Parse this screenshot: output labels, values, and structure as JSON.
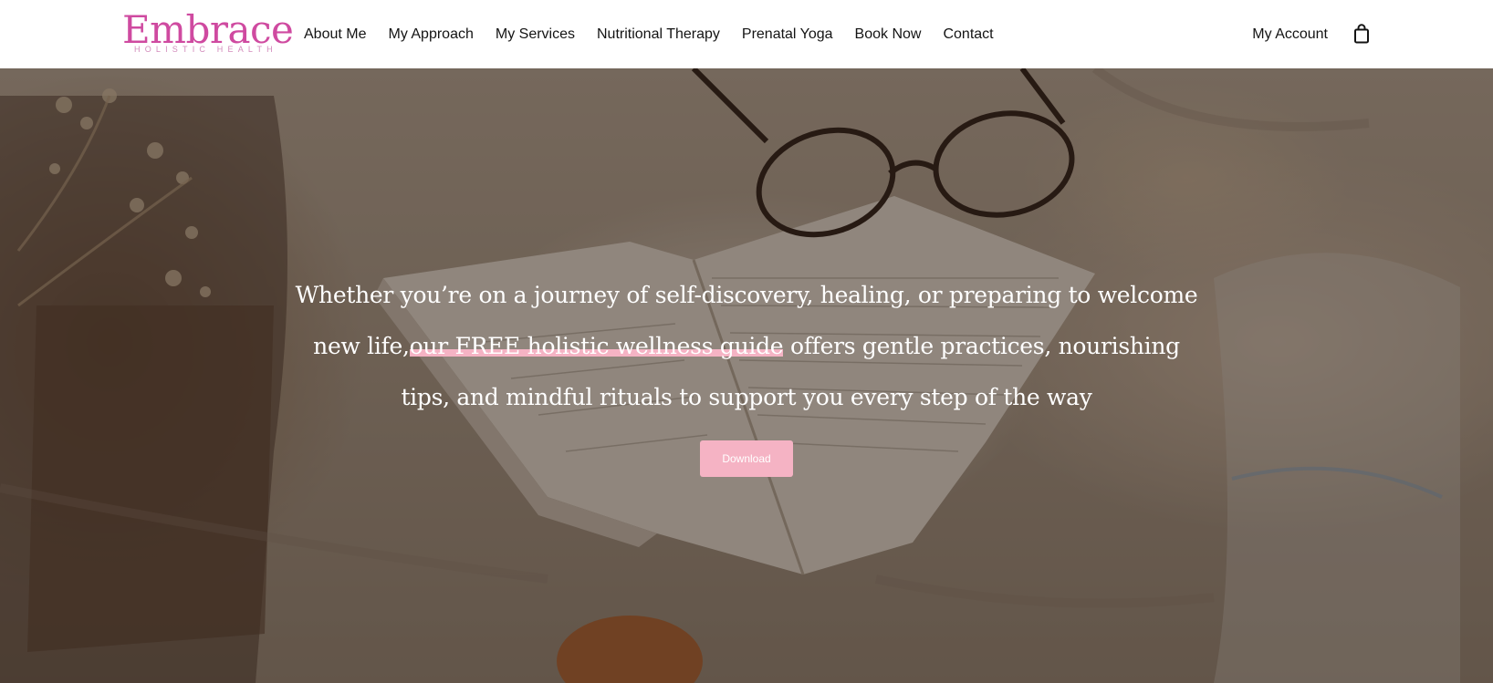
{
  "colors": {
    "brand_pink": "#cf4aa0",
    "button_pink": "#f5b3c4",
    "highlight_pink": "#f5b3c4"
  },
  "header": {
    "logo": {
      "word": "Embrace",
      "tagline": "HOLISTIC HEALTH"
    },
    "nav": [
      {
        "label": "About Me"
      },
      {
        "label": "My Approach"
      },
      {
        "label": "My Services"
      },
      {
        "label": "Nutritional Therapy"
      },
      {
        "label": "Prenatal Yoga"
      },
      {
        "label": "Book Now"
      },
      {
        "label": "Contact"
      }
    ],
    "account_label": "My Account",
    "cart_icon": "shopping-bag-icon"
  },
  "hero": {
    "text_before": "Whether you’re on a journey of self-discovery, healing, or preparing to welcome new life,",
    "link_text": "our FREE holistic wellness guide",
    "text_after": " offers gentle practices, nourishing tips, and mindful rituals to support you every step of the way",
    "button_label": "Download"
  }
}
